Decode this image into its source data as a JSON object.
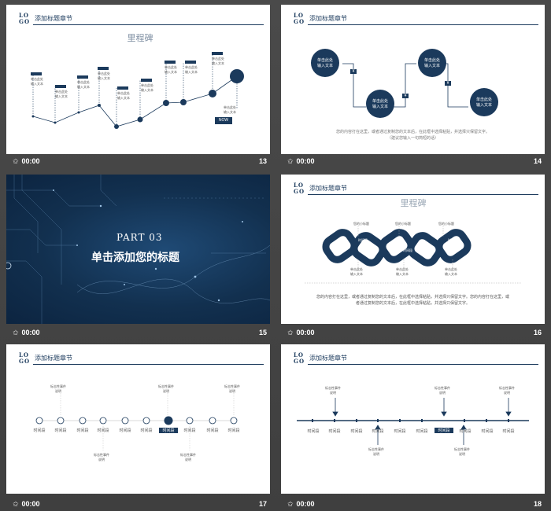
{
  "header": {
    "logo_top": "LO",
    "logo_bottom": "GO",
    "title": "添加标题章节"
  },
  "footer": {
    "time": "00:00"
  },
  "slides": {
    "s13": {
      "number": "13",
      "chart_title": "里程碑",
      "box_title": "单击此处",
      "box_text1": "单击此处",
      "box_text2": "输入文本",
      "now": "NOW",
      "right_text1": "单击此处",
      "right_text2": "输入文本"
    },
    "s14": {
      "number": "14",
      "circle_text1": "单击此处",
      "circle_text2": "输入文本",
      "tags": [
        "¥",
        "¥",
        "¥"
      ],
      "desc1": "您的内容打在这里，或者通过复制您的文本后，在此框中选择粘贴，并选择只保留文字。",
      "desc2": "（建议您输入一句简短的话）"
    },
    "s15": {
      "number": "15",
      "part": "PART 03",
      "title": "单击添加您的标题"
    },
    "s16": {
      "number": "16",
      "chart_title": "里程碑",
      "small_title": "您的小标题",
      "period": "时间段",
      "box_text1": "单击此处",
      "box_text2": "输入文本",
      "desc1": "您的内容打在这里，或者通过复制您的文本后，在此框中选择粘贴，并选择只保留文字。您的内容打在这里，或",
      "desc2": "者通过复制您的文本后，在此框中选择粘贴，并选择只保留文字。"
    },
    "s17": {
      "number": "17",
      "event1": "标志性事件",
      "event2": "说明",
      "period": "时间段"
    },
    "s18": {
      "number": "18",
      "event1": "标志性事件",
      "event2": "说明",
      "period": "时间段"
    }
  }
}
